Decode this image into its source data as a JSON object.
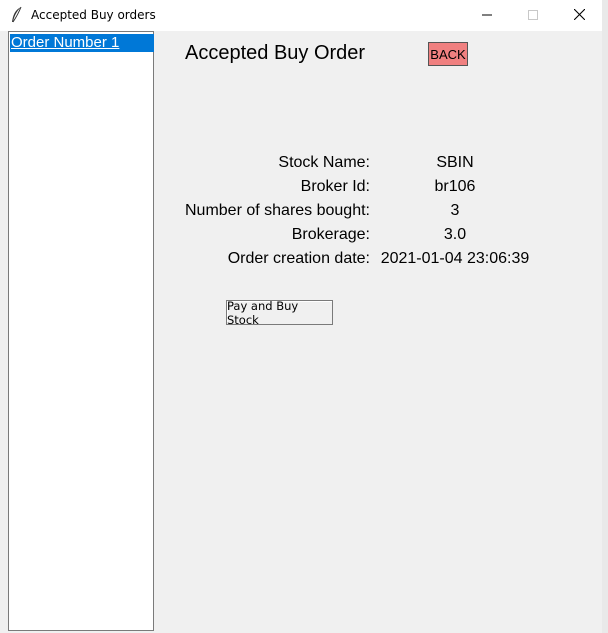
{
  "window": {
    "title": "Accepted Buy orders",
    "app_icon": "feather-icon",
    "controls": [
      "minimize-icon",
      "maximize-icon",
      "close-icon"
    ]
  },
  "sidebar": {
    "items": [
      {
        "label": "Order Number 1",
        "selected": true
      }
    ],
    "selected_color": "#0078d7"
  },
  "main": {
    "heading": "Accepted Buy Order",
    "back_label": "BACK",
    "back_color": "#f08080",
    "fields": [
      {
        "label": "Stock Name:",
        "value": "SBIN"
      },
      {
        "label": "Broker Id:",
        "value": "br106"
      },
      {
        "label": "Number of shares bought:",
        "value": "3"
      },
      {
        "label": "Brokerage:",
        "value": "3.0"
      },
      {
        "label": "Order creation date:",
        "value": "2021-01-04 23:06:39"
      }
    ],
    "pay_label": "Pay and Buy Stock"
  }
}
